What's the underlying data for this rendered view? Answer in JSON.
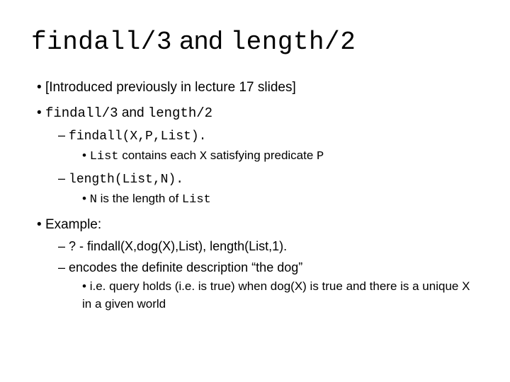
{
  "title": {
    "code1": "findall/3",
    "mid": " and ",
    "code2": "length/2"
  },
  "bullet1": "[Introduced previously in lecture 17 slides]",
  "bullet2": {
    "code1": "findall/3",
    "mid": " and ",
    "code2": "length/2"
  },
  "b2_sub1_item1": "findall(X,P,List).",
  "b2_sub2_item1": {
    "t1": "List",
    "t2": " contains each ",
    "t3": "X",
    "t4": " satisfying predicate ",
    "t5": "P"
  },
  "b2_sub1_item2": "length(List,N).",
  "b2_sub2_item2": {
    "t1": "N",
    "t2": " is the length of ",
    "t3": "List"
  },
  "bullet3": "Example:",
  "b3_sub1_item1": "? - findall(X,dog(X),List), length(List,1).",
  "b3_sub1_item2": "encodes the definite description “the dog”",
  "b3_sub2_item1": "i.e. query holds (i.e. is true) when dog(X) is true and there is a unique X in a given world"
}
